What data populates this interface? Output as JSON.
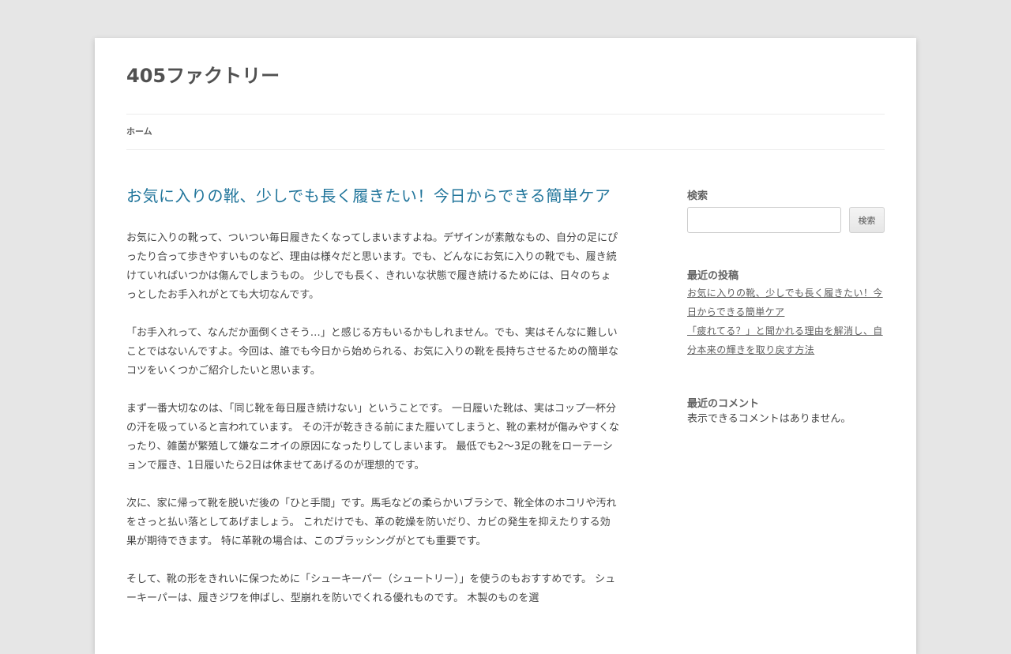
{
  "site": {
    "title": "405ファクトリー"
  },
  "nav": {
    "items": [
      {
        "label": "ホーム"
      }
    ]
  },
  "article": {
    "title": "お気に入りの靴、少しでも長く履きたい！今日からできる簡単ケア",
    "paragraphs": [
      "お気に入りの靴って、ついつい毎日履きたくなってしまいますよね。デザインが素敵なもの、自分の足にぴったり合って歩きやすいものなど、理由は様々だと思います。でも、どんなにお気に入りの靴でも、履き続けていればいつかは傷んでしまうもの。 少しでも長く、きれいな状態で履き続けるためには、日々のちょっとしたお手入れがとても大切なんです。",
      "「お手入れって、なんだか面倒くさそう…」と感じる方もいるかもしれません。でも、実はそんなに難しいことではないんですよ。今回は、誰でも今日から始められる、お気に入りの靴を長持ちさせるための簡単なコツをいくつかご紹介したいと思います。",
      "まず一番大切なのは、「同じ靴を毎日履き続けない」ということです。 一日履いた靴は、実はコップ一杯分の汗を吸っていると言われています。 その汗が乾ききる前にまた履いてしまうと、靴の素材が傷みやすくなったり、雑菌が繁殖して嫌なニオイの原因になったりしてしまいます。 最低でも2〜3足の靴をローテーションで履き、1日履いたら2日は休ませてあげるのが理想的です。",
      "次に、家に帰って靴を脱いだ後の「ひと手間」です。馬毛などの柔らかいブラシで、靴全体のホコリや汚れをさっと払い落としてあげましょう。 これだけでも、革の乾燥を防いだり、カビの発生を抑えたりする効果が期待できます。 特に革靴の場合は、このブラッシングがとても重要です。",
      "そして、靴の形をきれいに保つために「シューキーパー（シュートリー）」を使うのもおすすめです。 シューキーパーは、履きジワを伸ばし、型崩れを防いでくれる優れものです。 木製のものを選"
    ]
  },
  "sidebar": {
    "search": {
      "title": "検索",
      "button_label": "検索",
      "value": ""
    },
    "recent_posts": {
      "title": "最近の投稿",
      "items": [
        "お気に入りの靴、少しでも長く履きたい！今日からできる簡単ケア",
        "「疲れてる？」と聞かれる理由を解消し、自分本来の輝きを取り戻す方法"
      ]
    },
    "recent_comments": {
      "title": "最近のコメント",
      "empty_text": "表示できるコメントはありません。"
    }
  },
  "colors": {
    "page_background": "#e6e6e6",
    "card_background": "#ffffff",
    "link_blue": "#21759b",
    "text": "#444444"
  }
}
